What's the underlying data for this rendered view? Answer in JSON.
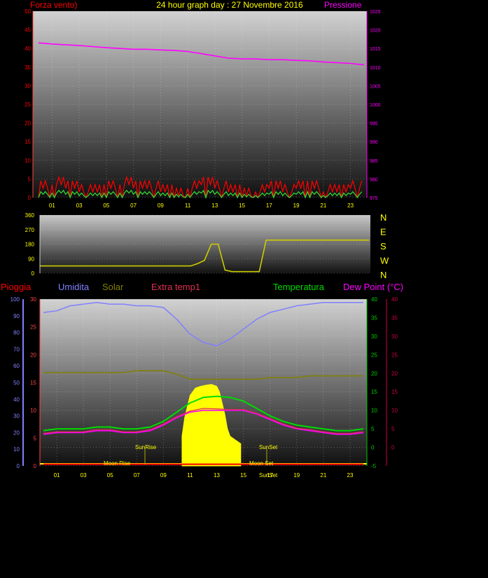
{
  "top": {
    "title": "24 hour graph day : 27 Novembre 2016",
    "left_label": "Forza vento)",
    "right_label": "Pressione",
    "left_ticks": [
      "0",
      "5",
      "10",
      "15",
      "20",
      "25",
      "30",
      "35",
      "40",
      "45",
      "50"
    ],
    "right_ticks": [
      "975",
      "980",
      "985",
      "990",
      "995",
      "1000",
      "1005",
      "1010",
      "1015",
      "1020",
      "1025"
    ],
    "colors": {
      "left": "#ff0000",
      "right": "#ff00ff",
      "title": "#ffff00",
      "x_ticks": "#ffff00"
    }
  },
  "wind_dir": {
    "ticks": [
      "0",
      "90",
      "180",
      "270",
      "360"
    ],
    "compass": [
      "N",
      "W",
      "S",
      "E",
      "N"
    ],
    "color": "#ffff00"
  },
  "bottom": {
    "labels": {
      "pioggia": "Pioggia",
      "umidita": "Umidita",
      "solar": "Solar",
      "extra": "Extra temp1",
      "temperatura": "Temperatura",
      "dewpoint": "Dew Point (°C)"
    },
    "label_colors": {
      "pioggia": "#ff0000",
      "umidita": "#8080ff",
      "solar": "#808000",
      "extra": "#e03050",
      "temperatura": "#00dd00",
      "dewpoint": "#ff00ff"
    },
    "hum_ticks": [
      "0",
      "10",
      "20",
      "30",
      "40",
      "50",
      "60",
      "70",
      "80",
      "90",
      "100"
    ],
    "rain_ticks": [
      "0",
      "5",
      "10",
      "15",
      "20",
      "25",
      "30"
    ],
    "temp_ticks": [
      "-5",
      "0",
      "5",
      "10",
      "15",
      "20",
      "25",
      "30",
      "35",
      "40"
    ],
    "dew_ticks": [
      "0",
      "5",
      "10",
      "15",
      "20",
      "25",
      "30",
      "35",
      "40"
    ],
    "annotations": {
      "sunrise": "SunRise",
      "sunset": "SunSet",
      "moonrise": "Moon Rise",
      "moonset": "Moon Set",
      "sunset_axis": "SunSet"
    }
  },
  "x_ticks": [
    "01",
    "03",
    "05",
    "07",
    "09",
    "11",
    "13",
    "15",
    "17",
    "19",
    "21",
    "23"
  ],
  "chart_data": [
    {
      "type": "line",
      "title": "24 hour graph day : 27 Novembre 2016",
      "x_unit": "hour",
      "x": [
        0,
        1,
        2,
        3,
        4,
        5,
        6,
        7,
        8,
        9,
        10,
        11,
        12,
        13,
        14,
        15,
        16,
        17,
        18,
        19,
        20,
        21,
        22,
        23,
        24
      ],
      "ylim_left": [
        0,
        50
      ],
      "ylim_right": [
        975,
        1025
      ],
      "series": [
        {
          "name": "Pressione",
          "axis": "right",
          "values": [
            1016.5,
            1016.2,
            1016.0,
            1015.8,
            1015.5,
            1015.2,
            1015.0,
            1014.8,
            1014.8,
            1014.6,
            1014.5,
            1014.2,
            1013.6,
            1013.0,
            1012.4,
            1012.2,
            1012.2,
            1012.0,
            1012.0,
            1011.8,
            1011.7,
            1011.4,
            1011.2,
            1011.0,
            1010.6
          ]
        },
        {
          "name": "Forza vento)",
          "axis": "left",
          "values": [
            3,
            4,
            3,
            2,
            2,
            3,
            4,
            3,
            3,
            2,
            1,
            3,
            4,
            3,
            2,
            1,
            2,
            3,
            2,
            3,
            3,
            2,
            2,
            3,
            2
          ]
        }
      ]
    },
    {
      "type": "line",
      "x_unit": "hour",
      "ylim": [
        0,
        360
      ],
      "x": [
        0,
        1,
        2,
        3,
        4,
        5,
        6,
        7,
        8,
        9,
        10,
        11,
        11.5,
        12,
        12.5,
        13,
        13.5,
        14,
        15,
        16,
        16.5,
        17,
        18,
        19,
        20,
        21,
        22,
        23,
        24
      ],
      "values": [
        45,
        45,
        45,
        45,
        45,
        45,
        45,
        45,
        45,
        45,
        45,
        45,
        60,
        80,
        180,
        180,
        20,
        10,
        10,
        10,
        205,
        205,
        205,
        205,
        205,
        205,
        205,
        205,
        205
      ]
    },
    {
      "type": "line",
      "x_unit": "hour",
      "x": [
        0,
        1,
        2,
        3,
        4,
        5,
        6,
        7,
        8,
        9,
        10,
        11,
        12,
        13,
        14,
        15,
        16,
        17,
        18,
        19,
        20,
        21,
        22,
        23,
        24
      ],
      "ylim_umidita": [
        0,
        100
      ],
      "ylim_temperatura": [
        -5,
        40
      ],
      "ylim_pioggia": [
        0,
        30
      ],
      "series": [
        {
          "name": "Umidita",
          "axis": "umidita",
          "values": [
            92,
            93,
            96,
            97,
            98,
            97,
            97,
            96,
            96,
            95,
            88,
            79,
            74,
            72,
            76,
            82,
            88,
            92,
            94,
            96,
            97,
            98,
            98,
            98,
            98
          ]
        },
        {
          "name": "Solar",
          "axis": "umidita",
          "values": [
            56,
            56,
            56,
            56,
            56,
            56,
            56,
            57,
            57,
            57,
            55,
            52,
            52,
            52,
            52,
            52,
            52,
            53,
            53,
            53,
            54,
            54,
            54,
            54,
            54
          ]
        },
        {
          "name": "Temperatura",
          "axis": "temperatura",
          "values": [
            4.5,
            5,
            5,
            5,
            5.5,
            5.5,
            5,
            5,
            5.5,
            7,
            9.5,
            12,
            13.5,
            13.8,
            13.5,
            12.5,
            10.5,
            8.5,
            7,
            6,
            5.5,
            5,
            4.5,
            4.5,
            5
          ]
        },
        {
          "name": "Dew Point (°C)",
          "axis": "temperatura",
          "values": [
            3.5,
            4,
            4,
            4,
            4.5,
            4.5,
            4,
            4,
            4.5,
            6,
            8,
            9.5,
            10,
            10,
            10,
            10,
            9,
            7.5,
            6,
            5,
            4.5,
            4,
            3.5,
            3.5,
            4
          ]
        },
        {
          "name": "Extra temp1",
          "axis": "temperatura",
          "values": [
            3.8,
            4.2,
            4.2,
            4.2,
            4.8,
            4.8,
            4.2,
            4.2,
            4.8,
            6.3,
            8.3,
            9.8,
            10.5,
            10.4,
            10.2,
            10.2,
            9.2,
            7.8,
            6.3,
            5.2,
            4.8,
            4.2,
            3.8,
            3.8,
            4.2
          ]
        },
        {
          "name": "Pioggia",
          "axis": "pioggia",
          "values": [
            0.3,
            0.3,
            0.3,
            0.3,
            0.3,
            0.3,
            0.3,
            0.3,
            0.3,
            0.3,
            0.3,
            0.3,
            0.3,
            0.3,
            0.3,
            0.3,
            0.3,
            0.3,
            0.3,
            0.3,
            0.3,
            0.3,
            0.3,
            0.3,
            0.3
          ]
        }
      ],
      "area": {
        "color": "#ffff00",
        "x": [
          10.4,
          10.6,
          11,
          11.4,
          11.8,
          12.2,
          12.6,
          13,
          13.2,
          13.4,
          13.6,
          13.8,
          14,
          14.4,
          14.8
        ],
        "values": [
          3,
          8,
          14,
          16,
          16.5,
          16.8,
          17,
          16.5,
          15,
          12,
          9,
          5,
          3,
          2,
          1
        ]
      }
    }
  ]
}
